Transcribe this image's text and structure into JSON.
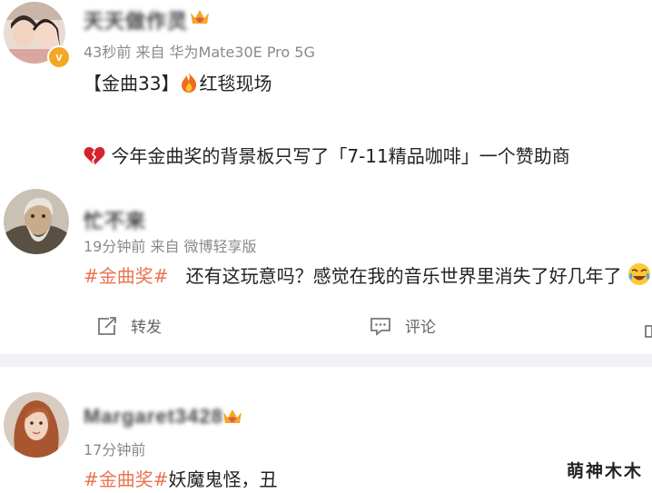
{
  "post1": {
    "username": "天天做作灵",
    "meta": "43秒前  来自 华为Mate30E Pro 5G",
    "line1": "【金曲33】",
    "line1_tail": "红毯现场",
    "line2": "今年金曲奖的背景板只写了「7-11精品咖啡」一个赞助商"
  },
  "post2": {
    "username": "忙不来",
    "meta": "19分钟前  来自 微博轻享版",
    "topic": "#金曲奖#",
    "text": "还有这玩意吗？感觉在我的音乐世界里消失了好几年了"
  },
  "actions": {
    "repost": "转发",
    "comment": "评论"
  },
  "post3": {
    "username": "Margaret3428",
    "meta": "17分钟前",
    "topic": "#金曲奖#",
    "text": "妖魔鬼怪，丑"
  },
  "watermark": "萌神木木",
  "colors": {
    "topic": "#eb7350",
    "crown": "#f5a623",
    "divider": "#f1f2f5"
  }
}
